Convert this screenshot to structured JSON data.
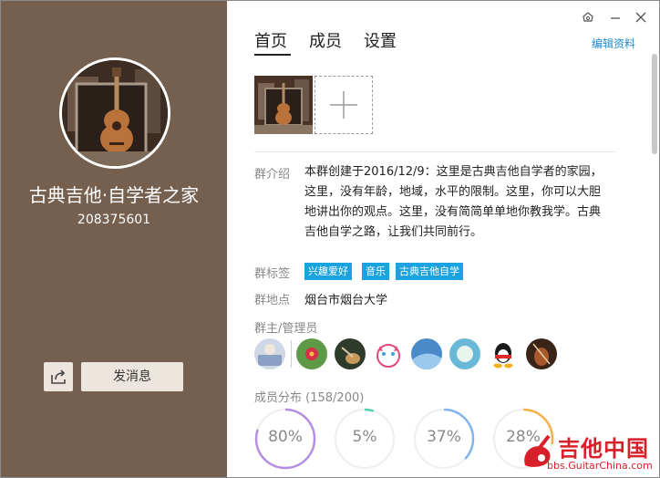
{
  "group": {
    "name": "古典吉他·自学者之家",
    "id": "208375601"
  },
  "actions": {
    "send_message": "发消息"
  },
  "tabs": [
    {
      "label": "首页"
    },
    {
      "label": "成员"
    },
    {
      "label": "设置"
    }
  ],
  "edit_profile": "编辑资料",
  "info": {
    "intro_label": "群介绍",
    "intro_text": "本群创建于2016/12/9：这里是古典吉他自学者的家园，这里，没有年龄，地域，水平的限制。这里，你可以大胆地讲出你的观点。这里，没有简简单单地你教我学。古典吉他自学之路，让我们共同前行。",
    "tags_label": "群标签",
    "tags": [
      "兴趣爱好",
      "音乐",
      "古典吉他自学"
    ],
    "location_label": "群地点",
    "location": "烟台市烟台大学",
    "admins_label": "群主/管理员"
  },
  "stats": {
    "title": "成员分布",
    "count": "(158/200)",
    "rings": [
      {
        "label": "80%",
        "value": 0.8,
        "color": "#b58ee0"
      },
      {
        "label": "5%",
        "value": 0.05,
        "color": "#58d0b0"
      },
      {
        "label": "37%",
        "value": 0.37,
        "color": "#7fb6ee"
      },
      {
        "label": "28%",
        "value": 0.28,
        "color": "#f4b04a"
      }
    ]
  },
  "watermark": {
    "text": "吉他中国",
    "url": "bbs.GuitarChina.com"
  },
  "icons": {
    "share": "share-icon",
    "skin": "skin-icon",
    "minimize": "minimize-icon",
    "close": "close-icon",
    "add": "plus-icon"
  },
  "colors": {
    "sidebar": "#75604f",
    "accent": "#1a8bd6",
    "tag": "#1ba3df"
  }
}
